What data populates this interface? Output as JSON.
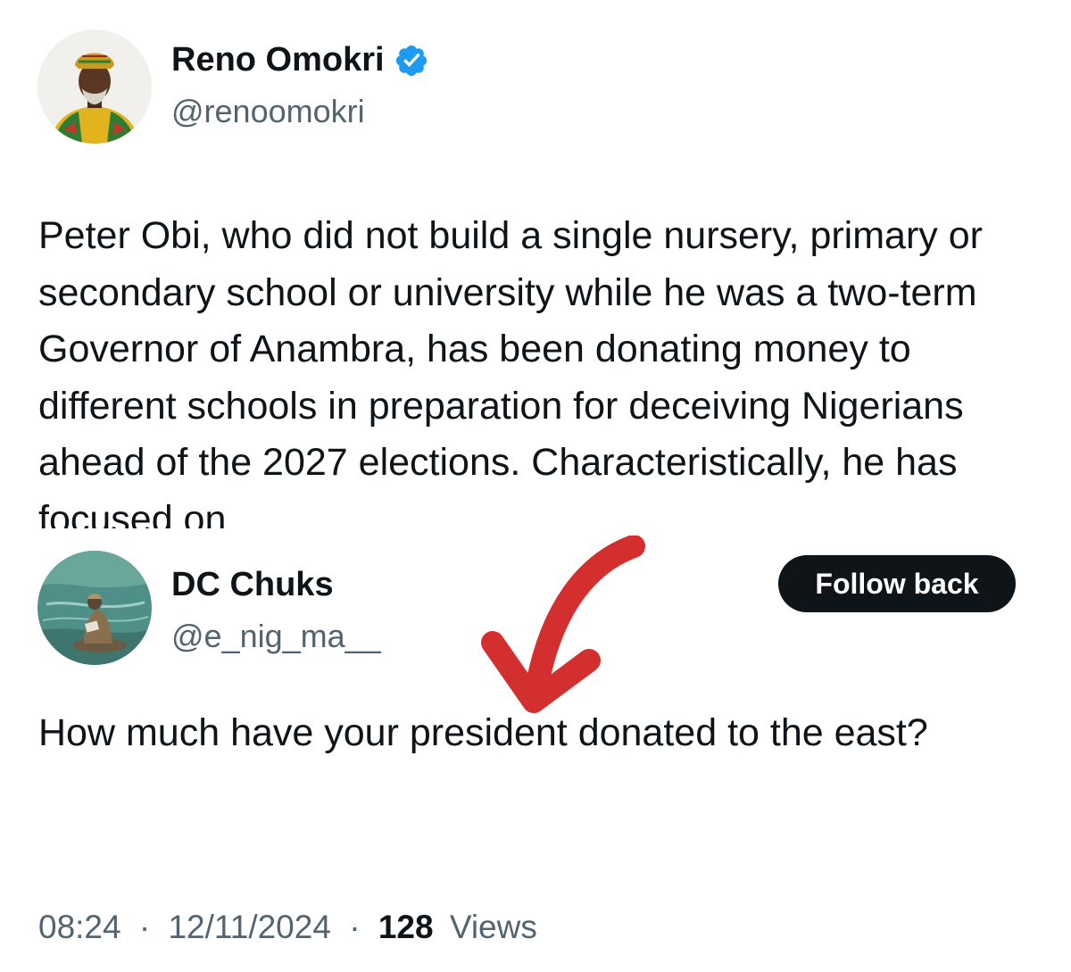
{
  "original_tweet": {
    "author_name": "Reno Omokri",
    "author_handle": "@renoomokri",
    "verified": true,
    "text": "Peter Obi, who did not build a single nursery, primary or secondary school or university while he was a two-term Governor of Anambra, has been donating money to different schools in preparation for deceiving Nigerians ahead of the 2027 elections. Characteristically, he has focused on"
  },
  "reply_tweet": {
    "author_name": "DC Chuks",
    "author_handle": "@e_nig_ma__",
    "follow_button_label": "Follow back",
    "text": "How much have your president donated to the east?",
    "time": "08:24",
    "separator": "·",
    "date": "12/11/2024",
    "views_count": "128",
    "views_label": "Views"
  },
  "colors": {
    "verified_badge": "#1d9bf0",
    "annotation_arrow": "#d32f2f",
    "follow_button_bg": "#0f1419",
    "secondary_text": "#536471"
  },
  "icons": {
    "verified": "verified-badge-icon",
    "annotation": "red-check-arrow-icon"
  }
}
